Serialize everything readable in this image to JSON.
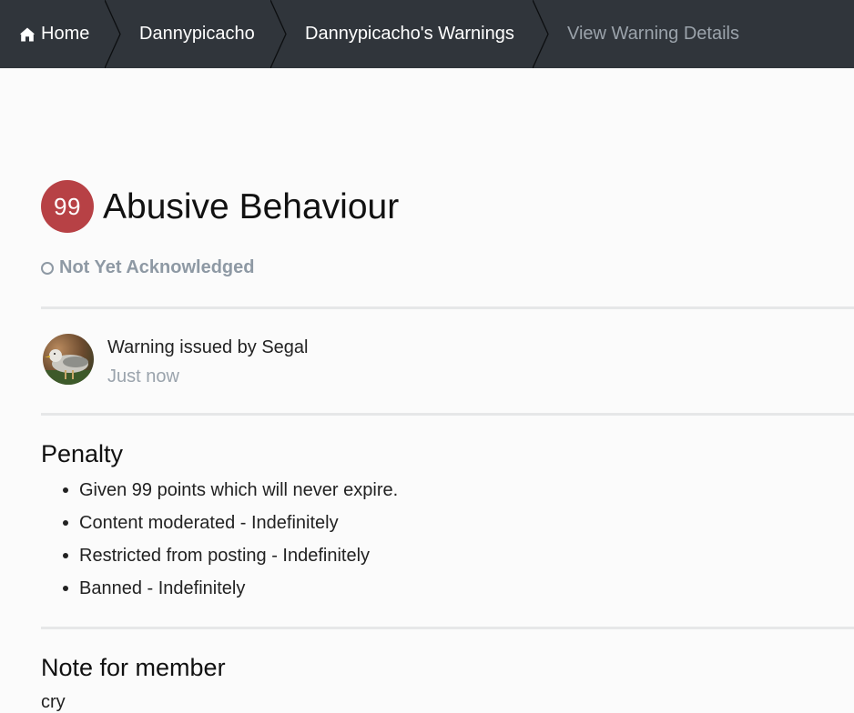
{
  "breadcrumb": {
    "home_label": "Home",
    "member_label": "Dannypicacho",
    "warnings_label": "Dannypicacho's Warnings",
    "current_label": "View Warning Details"
  },
  "warning": {
    "points": "99",
    "title": "Abusive Behaviour",
    "ack_status": "Not Yet Acknowledged"
  },
  "issuer": {
    "issued_by": "Warning issued by Segal",
    "time": "Just now"
  },
  "penalty": {
    "heading": "Penalty",
    "items": [
      "Given 99 points which will never expire.",
      "Content moderated - Indefinitely",
      "Restricted from posting - Indefinitely",
      "Banned - Indefinitely"
    ]
  },
  "note": {
    "heading": "Note for member",
    "text": "cry"
  },
  "colors": {
    "header_bg": "#30353b",
    "badge_bg": "#b74145",
    "muted_text": "#8e99a4",
    "page_bg": "#fbfbfb"
  },
  "icons": {
    "home": "home-icon",
    "status": "circle-outline-icon",
    "avatar": "user-avatar-bird-photo"
  }
}
